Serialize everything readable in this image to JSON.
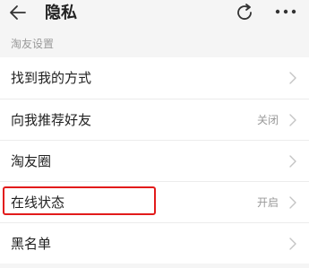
{
  "header": {
    "title": "隐私",
    "back_icon": "arrow-left-icon",
    "refresh_icon": "refresh-icon",
    "more_icon": "more-dots-icon"
  },
  "section": {
    "label": "淘友设置"
  },
  "rows": [
    {
      "label": "找到我的方式",
      "value": ""
    },
    {
      "label": "向我推荐好友",
      "value": "关闭"
    },
    {
      "label": "淘友圈",
      "value": ""
    },
    {
      "label": "在线状态",
      "value": "开启"
    },
    {
      "label": "黑名单",
      "value": ""
    }
  ],
  "colors": {
    "highlight": "#e21b1b",
    "background": "#f5f5f5",
    "row_background": "#ffffff"
  }
}
